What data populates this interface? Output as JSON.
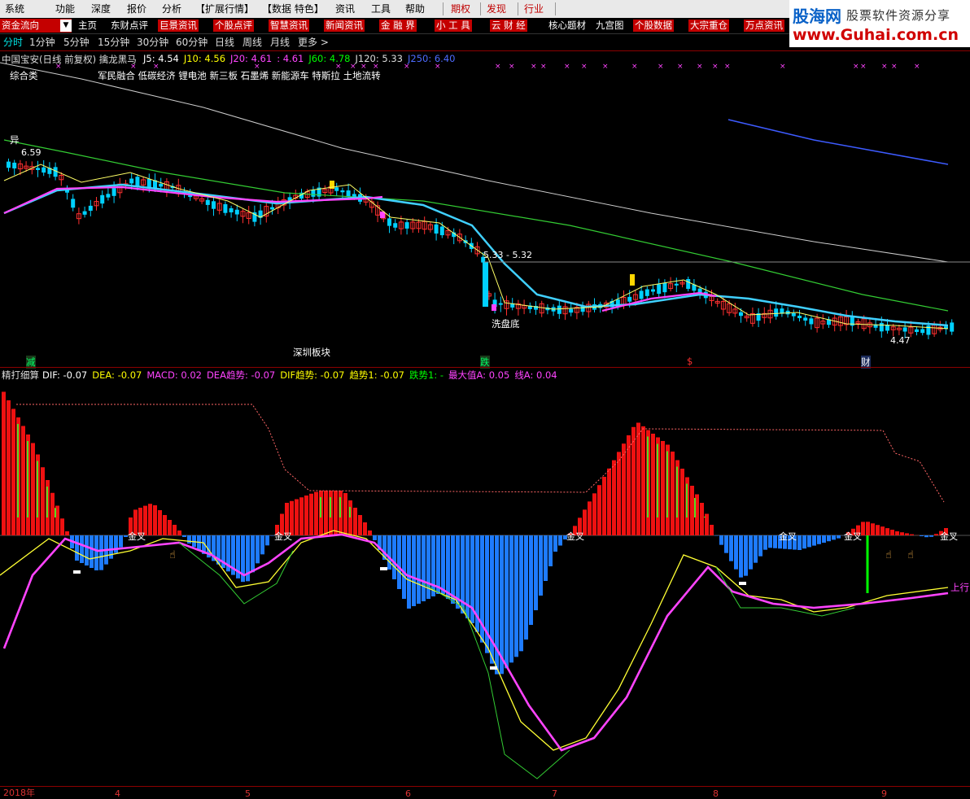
{
  "menubar": {
    "items": [
      "系统",
      "功能",
      "深度",
      "报价",
      "分析",
      "【扩展行情】",
      "【数据 特色】",
      "资讯",
      "工具",
      "帮助",
      "期权",
      "发现",
      "行业"
    ]
  },
  "logo": {
    "brand": "股海网",
    "slogan": "股票软件资源分享",
    "url": "www.Guhai.com.cn"
  },
  "toolbar": {
    "dropdown": "资金流向",
    "items": [
      "主页",
      "东财点评",
      "巨景资讯",
      "个股点评",
      "智慧资讯",
      "新闻资讯",
      "金 融 界",
      "小 工 具",
      "云 财 经",
      "核心题材",
      "九宫图",
      "个股数据",
      "大宗重仓",
      "万点资讯"
    ]
  },
  "periods": {
    "items": [
      "分时",
      "1分钟",
      "5分钟",
      "15分钟",
      "30分钟",
      "60分钟",
      "日线",
      "周线",
      "月线",
      "更多 >"
    ],
    "active": "分时"
  },
  "main_chart": {
    "stock": "中国宝安(日线 前复权) 擒龙黑马",
    "ma": [
      {
        "label": "J5: 4.54",
        "color": "#ffffff"
      },
      {
        "label": "J10: 4.56",
        "color": "#ffff00"
      },
      {
        "label": "J20: 4.61",
        "color": "#ff44ff"
      },
      {
        "label": ": 4.61",
        "color": "#ff44ff"
      },
      {
        "label": "J60: 4.78",
        "color": "#00ff00"
      },
      {
        "label": "J120: 5.33",
        "color": "#dddddd"
      },
      {
        "label": "J250: 6.40",
        "color": "#4d6bff"
      }
    ],
    "sector": "综合类",
    "concepts": "军民融合 低碳经济 锂电池 新三板 石墨烯 新能源车 特斯拉 土地流转",
    "annotations": {
      "yi": "异",
      "high": "6.59",
      "range": "5.33 - 5.32",
      "xipan": "洗盘底",
      "low": "4.47",
      "board": "深圳板块",
      "jian": "减",
      "die": "跌",
      "dollar": "$",
      "cai": "财"
    }
  },
  "macd_panel": {
    "title": "精打细算",
    "indicators": [
      {
        "label": "DIF: -0.07",
        "color": "#ffffff"
      },
      {
        "label": "DEA: -0.07",
        "color": "#ffff00"
      },
      {
        "label": "MACD: 0.02",
        "color": "#ff44ff"
      },
      {
        "label": "DEA趋势: -0.07",
        "color": "#ff44ff"
      },
      {
        "label": "DIF趋势: -0.07",
        "color": "#ffff00"
      },
      {
        "label": "趋势1: -0.07",
        "color": "#ffff00"
      },
      {
        "label": "跌势1: -",
        "color": "#00ff00"
      },
      {
        "label": "最大值A: 0.05",
        "color": "#ff44ff"
      },
      {
        "label": "线A: 0.04",
        "color": "#ff44ff"
      }
    ],
    "cross_label": "金叉",
    "up_label": "上行"
  },
  "time_axis": {
    "labels": [
      "2018年",
      "4",
      "5",
      "6",
      "7",
      "8",
      "9"
    ]
  },
  "colors": {
    "up": "#ff3030",
    "down": "#00d0ff",
    "bg": "#000000",
    "accent": "#c40000"
  }
}
